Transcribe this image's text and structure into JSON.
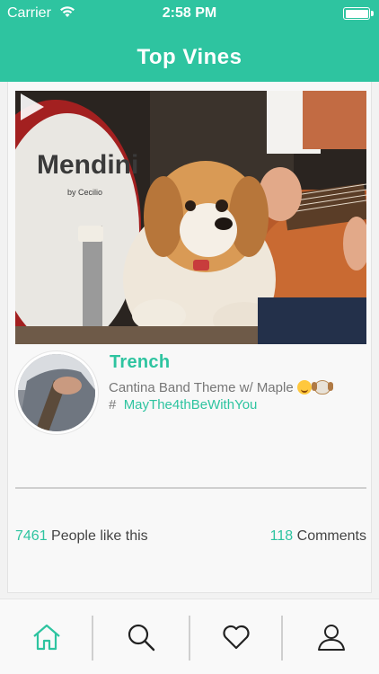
{
  "status_bar": {
    "carrier": "Carrier",
    "time": "2:58 PM",
    "icons": [
      "wifi-icon",
      "battery-icon"
    ]
  },
  "nav": {
    "title": "Top Vines"
  },
  "post": {
    "title": "Trench",
    "description_line1": "Cantina Band Theme w/ Maple",
    "description_emojis": [
      "smiling-face-emoji",
      "dog-face-emoji"
    ],
    "hashtag_prefix": "#",
    "hashtag": "MayThe4thBeWithYou",
    "drum_brand": "Mendini",
    "drum_brand_sub": "by Cecilio",
    "likes_count": "7461",
    "likes_label": "People like this",
    "comments_count": "118",
    "comments_label": "Comments"
  },
  "tabbar": {
    "items": [
      {
        "name": "home",
        "icon": "home-icon",
        "active": true
      },
      {
        "name": "search",
        "icon": "search-icon",
        "active": false
      },
      {
        "name": "likes",
        "icon": "heart-icon",
        "active": false
      },
      {
        "name": "profile",
        "icon": "user-icon",
        "active": false
      }
    ]
  },
  "colors": {
    "accent": "#2ec4a0",
    "text": "#444444",
    "muted": "#777777"
  }
}
